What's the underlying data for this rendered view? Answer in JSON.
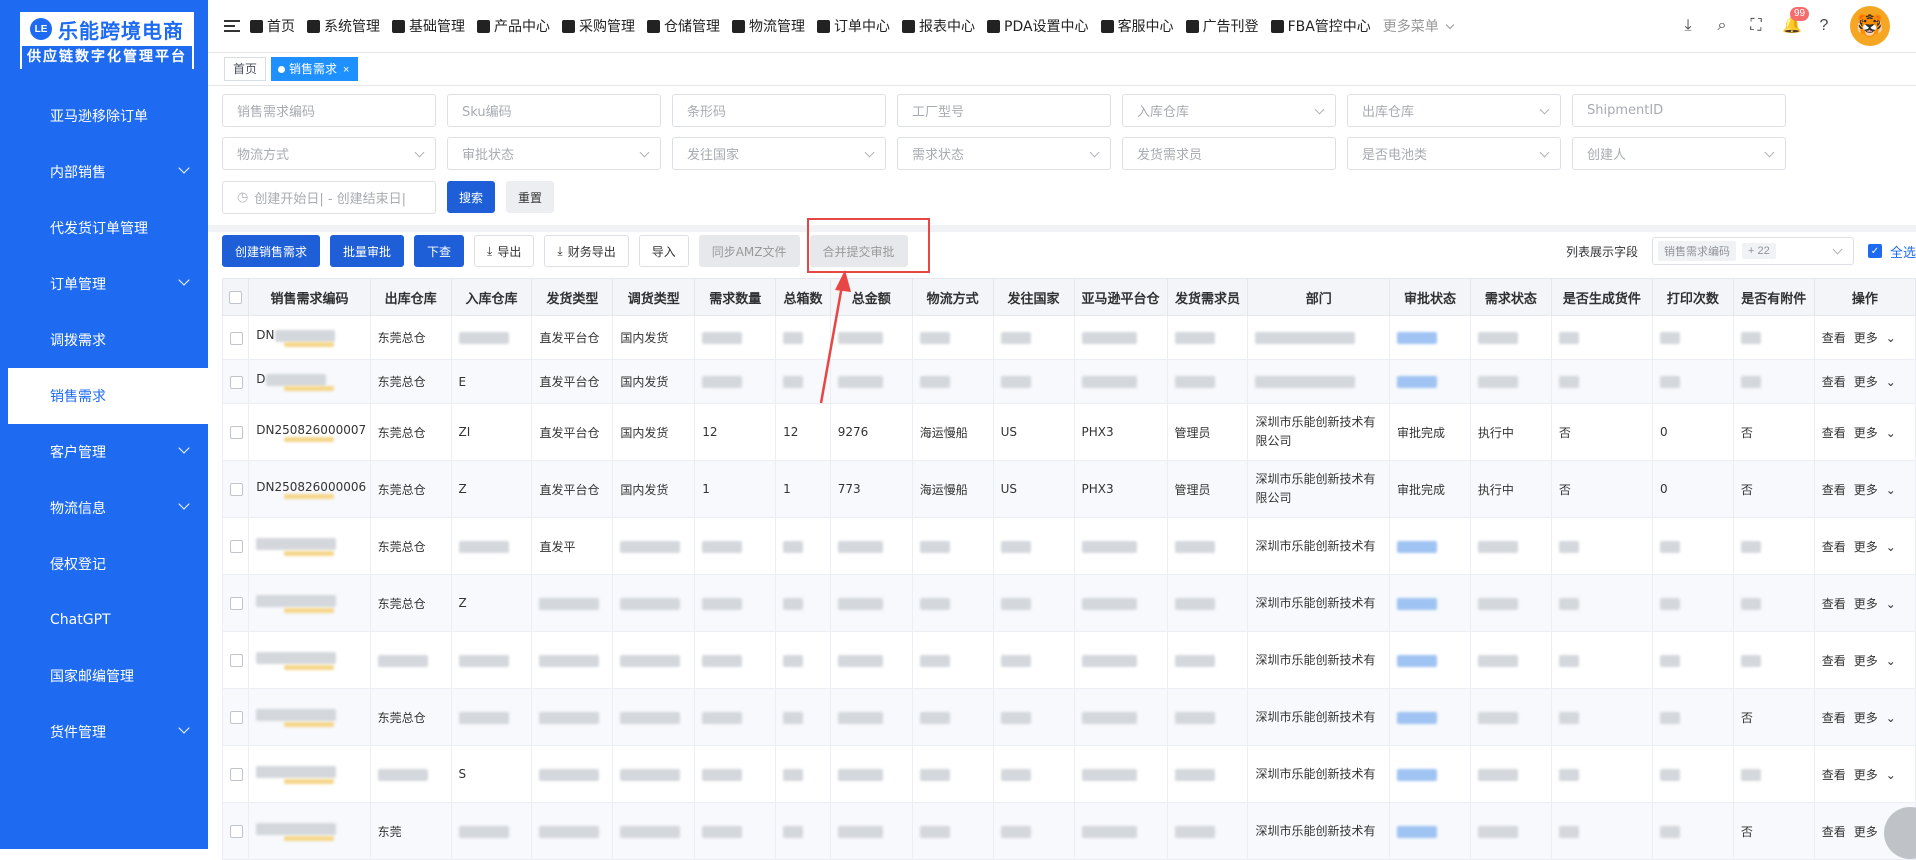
{
  "brand": {
    "title": "乐能跨境电商",
    "subtitle": "供应链数字化管理平台",
    "badge": "LE"
  },
  "sidebar": {
    "items": [
      {
        "label": "亚马逊移除订单",
        "expandable": false,
        "active": false
      },
      {
        "label": "内部销售",
        "expandable": true,
        "active": false
      },
      {
        "label": "代发货订单管理",
        "expandable": false,
        "active": false
      },
      {
        "label": "订单管理",
        "expandable": true,
        "active": false
      },
      {
        "label": "调拨需求",
        "expandable": false,
        "active": false
      },
      {
        "label": "销售需求",
        "expandable": false,
        "active": true
      },
      {
        "label": "客户管理",
        "expandable": true,
        "active": false
      },
      {
        "label": "物流信息",
        "expandable": true,
        "active": false
      },
      {
        "label": "侵权登记",
        "expandable": false,
        "active": false
      },
      {
        "label": "ChatGPT",
        "expandable": false,
        "active": false
      },
      {
        "label": "国家邮编管理",
        "expandable": false,
        "active": false
      },
      {
        "label": "货件管理",
        "expandable": true,
        "active": false
      }
    ]
  },
  "topnav": {
    "items": [
      "首页",
      "系统管理",
      "基础管理",
      "产品中心",
      "采购管理",
      "仓储管理",
      "物流管理",
      "订单中心",
      "报表中心",
      "PDA设置中心",
      "客服中心",
      "广告刊登",
      "FBA管控中心"
    ],
    "more": "更多菜单",
    "notif_count": "99"
  },
  "tabs": {
    "home": "首页",
    "active": "销售需求",
    "close": "×"
  },
  "filters": {
    "row1": [
      "销售需求编码",
      "Sku编码",
      "条形码",
      "工厂型号",
      "入库仓库",
      "出库仓库",
      "ShipmentID"
    ],
    "row2": [
      "物流方式",
      "审批状态",
      "发往国家",
      "需求状态",
      "发货需求员",
      "是否电池类",
      "创建人"
    ],
    "date_placeholder": "创建开始日|  -  创建结束日|",
    "search": "搜索",
    "reset": "重置"
  },
  "toolbar": {
    "create": "创建销售需求",
    "batch_approve": "批量审批",
    "issue": "下查",
    "export": "导出",
    "finance_export": "财务导出",
    "import": "导入",
    "sync_amz": "同步AMZ文件",
    "merge_submit": "合并提交审批",
    "columns_label": "列表展示字段",
    "columns_tag": "销售需求编码",
    "columns_more": "+ 22",
    "select_all": "全选"
  },
  "table": {
    "headers": [
      "销售需求编码",
      "出库仓库",
      "入库仓库",
      "发货类型",
      "调货类型",
      "需求数量",
      "总箱数",
      "总金额",
      "物流方式",
      "发往国家",
      "亚马逊平台仓",
      "发货需求员",
      "部门",
      "审批状态",
      "需求状态",
      "是否生成货件",
      "打印次数",
      "是否有附件",
      "操作"
    ],
    "ops_view": "查看",
    "ops_more": "更多",
    "rows": [
      {
        "code": "DN",
        "out": "东莞总仓",
        "in": "",
        "ship_type": "直发平台仓",
        "transfer": "国内发货",
        "qty": "",
        "boxes": "",
        "amount": "",
        "logistics": "",
        "country": "",
        "amz": "",
        "requester": "",
        "dept": "",
        "approval": "",
        "status": "",
        "gen": "",
        "prints": "",
        "attach": ""
      },
      {
        "code": "D",
        "out": "东莞总仓",
        "in": "E",
        "ship_type": "直发平台仓",
        "transfer": "国内发货",
        "qty": "",
        "boxes": "",
        "amount": "",
        "logistics": "",
        "country": "",
        "amz": "",
        "requester": "",
        "dept": "",
        "approval": "",
        "status": "",
        "gen": "",
        "prints": "",
        "attach": ""
      },
      {
        "code": "DN250826000007",
        "out": "东莞总仓",
        "in": "ZI",
        "ship_type": "直发平台仓",
        "transfer": "国内发货",
        "qty": "12",
        "boxes": "12",
        "amount": "9276",
        "logistics": "海运慢船",
        "country": "US",
        "amz": "PHX3",
        "requester": "管理员",
        "dept": "深圳市乐能创新技术有限公司",
        "approval": "审批完成",
        "status": "执行中",
        "gen": "否",
        "prints": "0",
        "attach": "否"
      },
      {
        "code": "DN250826000006",
        "out": "东莞总仓",
        "in": "Z",
        "ship_type": "直发平台仓",
        "transfer": "国内发货",
        "qty": "1",
        "boxes": "1",
        "amount": "773",
        "logistics": "海运慢船",
        "country": "US",
        "amz": "PHX3",
        "requester": "管理员",
        "dept": "深圳市乐能创新技术有限公司",
        "approval": "审批完成",
        "status": "执行中",
        "gen": "否",
        "prints": "0",
        "attach": "否"
      },
      {
        "code": "",
        "out": "东莞总仓",
        "in": "",
        "ship_type": "直发平",
        "transfer": "",
        "qty": "",
        "boxes": "",
        "amount": "",
        "logistics": "",
        "country": "",
        "amz": "",
        "requester": "",
        "dept": "深圳市乐能创新技术有",
        "approval": "",
        "status": "",
        "gen": "",
        "prints": "",
        "attach": ""
      },
      {
        "code": "",
        "out": "东莞总仓",
        "in": "Z",
        "ship_type": "",
        "transfer": "",
        "qty": "",
        "boxes": "",
        "amount": "",
        "logistics": "",
        "country": "",
        "amz": "",
        "requester": "",
        "dept": "深圳市乐能创新技术有",
        "approval": "",
        "status": "",
        "gen": "",
        "prints": "",
        "attach": ""
      },
      {
        "code": "",
        "out": "",
        "in": "",
        "ship_type": "",
        "transfer": "",
        "qty": "",
        "boxes": "",
        "amount": "",
        "logistics": "",
        "country": "",
        "amz": "",
        "requester": "",
        "dept": "深圳市乐能创新技术有",
        "approval": "",
        "status": "",
        "gen": "",
        "prints": "",
        "attach": ""
      },
      {
        "code": "",
        "out": "东莞总仓",
        "in": "",
        "ship_type": "",
        "transfer": "",
        "qty": "",
        "boxes": "",
        "amount": "",
        "logistics": "",
        "country": "",
        "amz": "",
        "requester": "",
        "dept": "深圳市乐能创新技术有",
        "approval": "",
        "status": "",
        "gen": "",
        "prints": "",
        "attach": "否"
      },
      {
        "code": "",
        "out": "",
        "in": "S",
        "ship_type": "",
        "transfer": "",
        "qty": "",
        "boxes": "",
        "amount": "",
        "logistics": "",
        "country": "",
        "amz": "",
        "requester": "",
        "dept": "深圳市乐能创新技术有",
        "approval": "",
        "status": "",
        "gen": "",
        "prints": "",
        "attach": ""
      },
      {
        "code": "",
        "out": "东莞",
        "in": "",
        "ship_type": "",
        "transfer": "",
        "qty": "",
        "boxes": "",
        "amount": "",
        "logistics": "",
        "country": "",
        "amz": "",
        "requester": "",
        "dept": "深圳市乐能创新技术有",
        "approval": "",
        "status": "",
        "gen": "",
        "prints": "",
        "attach": "否"
      }
    ]
  },
  "colors": {
    "primary": "#1e6bf2",
    "highlight": "#e84545"
  }
}
